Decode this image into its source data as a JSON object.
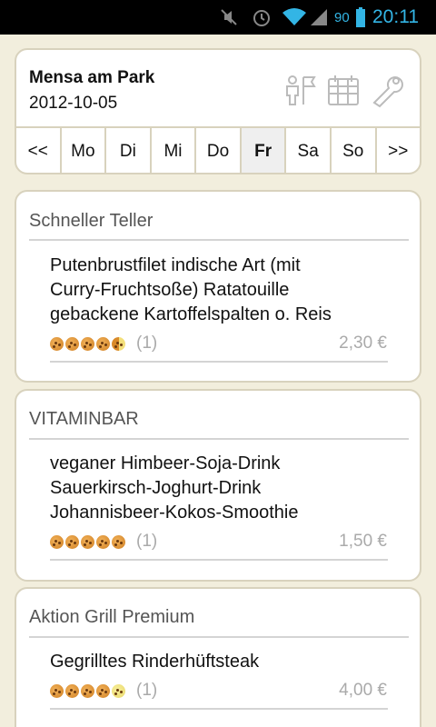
{
  "status_bar": {
    "battery_percent": "90",
    "time": "20:11",
    "icons": [
      "mute-icon",
      "alarm-icon",
      "wifi-icon",
      "signal-icon",
      "battery-icon"
    ]
  },
  "header": {
    "mensa_name": "Mensa am Park",
    "date": "2012-10-05",
    "icons": [
      "map-icon",
      "calendar-icon",
      "settings-icon"
    ]
  },
  "days": {
    "prev": "<<",
    "mo": "Mo",
    "di": "Di",
    "mi": "Mi",
    "do": "Do",
    "fr": "Fr",
    "sa": "Sa",
    "so": "So",
    "next": ">>",
    "selected": "Fr"
  },
  "categories": [
    {
      "title": "Schneller Teller",
      "dish_lines": [
        "Putenbrustfilet indische Art (mit",
        "Curry-Fruchtsoße) Ratatouille",
        "gebackene Kartoffelspalten o. Reis"
      ],
      "rating": 4.5,
      "rating_count": "(1)",
      "price": "2,30 €"
    },
    {
      "title": "VITAMINBAR",
      "dish_lines": [
        "veganer Himbeer-Soja-Drink",
        "Sauerkirsch-Joghurt-Drink",
        "Johannisbeer-Kokos-Smoothie"
      ],
      "rating": 5,
      "rating_count": "(1)",
      "price": "1,50 €"
    },
    {
      "title": "Aktion Grill Premium",
      "dish_lines": [
        "Gegrilltes Rinderhüftsteak"
      ],
      "rating": 4,
      "rating_count": "(1)",
      "price": "4,00 €"
    }
  ],
  "colors": {
    "background": "#f2eedd",
    "accent": "#33b5e5",
    "card_border": "#d8d2bd"
  }
}
